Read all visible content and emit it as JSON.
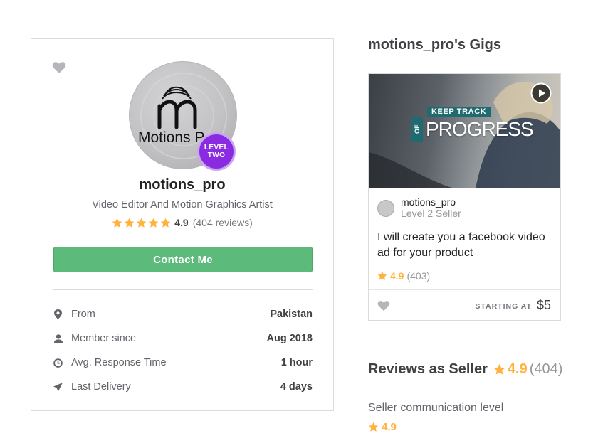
{
  "profile": {
    "username": "motions_pro",
    "tagline": "Video Editor And Motion Graphics Artist",
    "avatar_text": "Motions P",
    "level_badge": [
      "LEVEL",
      "TWO"
    ],
    "rating": "4.9",
    "reviews": "(404 reviews)",
    "contact_label": "Contact Me",
    "stats": [
      {
        "icon": "location-pin-icon",
        "label": "From",
        "value": "Pakistan"
      },
      {
        "icon": "user-icon",
        "label": "Member since",
        "value": "Aug 2018"
      },
      {
        "icon": "clock-icon",
        "label": "Avg. Response Time",
        "value": "1 hour"
      },
      {
        "icon": "paper-plane-icon",
        "label": "Last Delivery",
        "value": "4 days"
      }
    ]
  },
  "gigs": {
    "title": "motions_pro's Gigs",
    "card": {
      "thumb_keep_track": "KEEP TRACK",
      "thumb_of": "OF",
      "thumb_progress": "PROGRESS",
      "seller_name": "motions_pro",
      "seller_level": "Level 2 Seller",
      "title": "I will create you a facebook video ad for your product",
      "rating": "4.9",
      "rating_count": "(403)",
      "starting_at": "STARTING AT",
      "price": "$5"
    }
  },
  "reviews": {
    "title": "Reviews as Seller",
    "score": "4.9",
    "count": "(404)",
    "communication_label": "Seller communication level",
    "communication_score": "4.9"
  },
  "colors": {
    "accent_green": "#5cbb7a",
    "star_gold": "#ffb33e",
    "level_purple": "#8a2be2"
  }
}
